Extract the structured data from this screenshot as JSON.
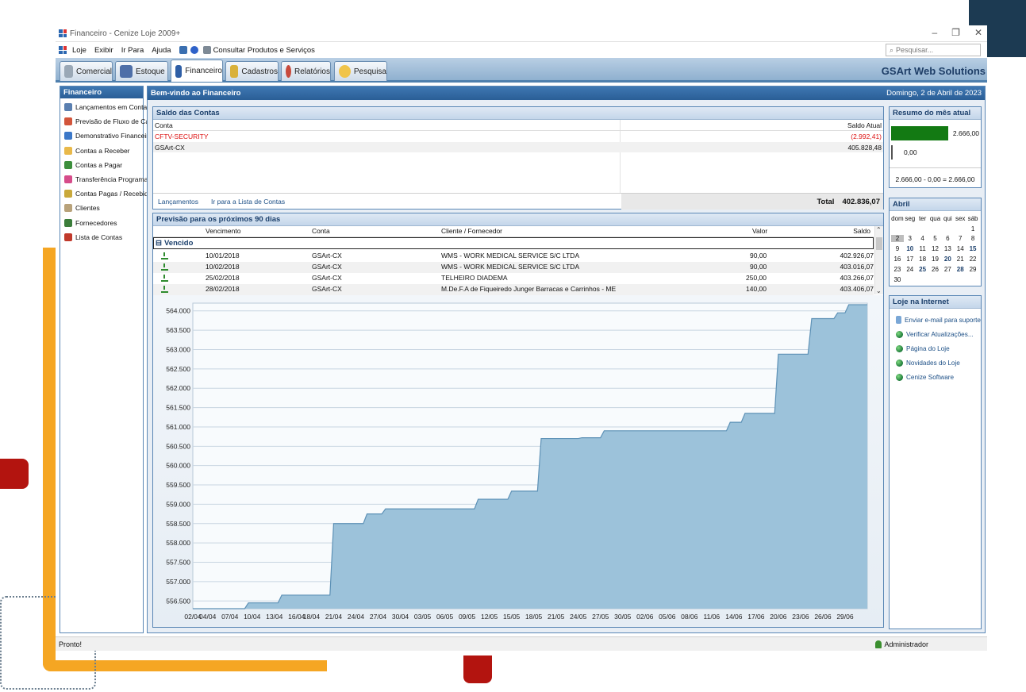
{
  "window": {
    "title": "Financeiro - Cenize Loje 2009+"
  },
  "menubar": {
    "items": [
      "Loje",
      "Exibir",
      "Ir Para",
      "Ajuda"
    ],
    "consultar": "Consultar Produtos e Serviços",
    "search_placeholder": "Pesquisar..."
  },
  "tabs": [
    "Comercial",
    "Estoque",
    "Financeiro",
    "Cadastros",
    "Relatórios",
    "Pesquisa"
  ],
  "brand": "GSArt Web Solutions",
  "sidebar": {
    "title": "Financeiro",
    "items": [
      "Lançamentos em Conta",
      "Previsão de Fluxo de Caixa",
      "Demonstrativo Financeiro",
      "Contas a Receber",
      "Contas a Pagar",
      "Transferência Programada",
      "Contas Pagas / Recebidas",
      "Clientes",
      "Fornecedores",
      "Lista de Contas"
    ]
  },
  "main": {
    "title": "Bem-vindo ao Financeiro",
    "date": "Domingo, 2 de Abril de 2023"
  },
  "saldo": {
    "title": "Saldo das Contas",
    "col_conta": "Conta",
    "col_saldo": "Saldo Atual",
    "rows": [
      {
        "conta": "CFTV-SECURITY",
        "saldo": "(2.992,41)"
      },
      {
        "conta": "GSArt-CX",
        "saldo": "405.828,48"
      }
    ],
    "link_lancamentos": "Lançamentos",
    "link_lista": "Ir para a Lista de Contas",
    "total_label": "Total",
    "total_value": "402.836,07"
  },
  "previsao": {
    "title": "Previsão para os próximos 90 dias",
    "cols": [
      "Vencimento",
      "Conta",
      "Cliente / Fornecedor",
      "Valor",
      "Saldo"
    ],
    "group": "Vencido",
    "rows": [
      {
        "venc": "10/01/2018",
        "conta": "GSArt-CX",
        "cliente": "WMS - WORK MEDICAL SERVICE S/C LTDA",
        "valor": "90,00",
        "saldo": "402.926,07"
      },
      {
        "venc": "10/02/2018",
        "conta": "GSArt-CX",
        "cliente": "WMS - WORK MEDICAL SERVICE S/C LTDA",
        "valor": "90,00",
        "saldo": "403.016,07"
      },
      {
        "venc": "25/02/2018",
        "conta": "GSArt-CX",
        "cliente": "TELHEIRO DIADEMA",
        "valor": "250,00",
        "saldo": "403.266,07"
      },
      {
        "venc": "28/02/2018",
        "conta": "GSArt-CX",
        "cliente": "M.De.F.A de Fiqueiredo Junger Barracas e Carrinhos - ME",
        "valor": "140,00",
        "saldo": "403.406,07"
      }
    ]
  },
  "chart_data": {
    "type": "area",
    "ylim": [
      556300,
      564200
    ],
    "yticks": [
      556500,
      557000,
      557500,
      558000,
      558500,
      559000,
      559500,
      560000,
      560500,
      561000,
      561500,
      562000,
      562500,
      563000,
      563500,
      564000
    ],
    "ytick_labels": [
      "556.500",
      "557.000",
      "557.500",
      "558.000",
      "558.500",
      "559.000",
      "559.500",
      "560.000",
      "560.500",
      "561.000",
      "561.500",
      "562.000",
      "562.500",
      "563.000",
      "563.500",
      "564.000"
    ],
    "xtick_labels": [
      "02/04",
      "04/04",
      "07/04",
      "10/04",
      "13/04",
      "16/04",
      "18/04",
      "21/04",
      "24/04",
      "27/04",
      "30/04",
      "03/05",
      "06/05",
      "09/05",
      "12/05",
      "15/05",
      "18/05",
      "21/05",
      "24/05",
      "27/05",
      "30/05",
      "02/06",
      "05/06",
      "08/06",
      "11/06",
      "14/06",
      "17/06",
      "20/06",
      "23/06",
      "26/06",
      "29/06"
    ],
    "x_days": [
      0,
      2,
      5,
      8,
      11,
      14,
      16,
      19,
      22,
      25,
      28,
      31,
      34,
      37,
      40,
      43,
      46,
      49,
      52,
      55,
      58,
      61,
      64,
      67,
      70,
      73,
      76,
      79,
      82,
      85,
      88
    ],
    "points_day": [
      0,
      7,
      7.5,
      11.5,
      12,
      16,
      16.5,
      18.5,
      19,
      23,
      23.5,
      25.5,
      26,
      38,
      38.5,
      42.5,
      43,
      46.5,
      47,
      52,
      52.5,
      55,
      55.5,
      67,
      67.5,
      72,
      72.5,
      74,
      74.5,
      78.5,
      79,
      83,
      83.5,
      86.5,
      87,
      88,
      88.5,
      91
    ],
    "points_value": [
      556300,
      556300,
      556450,
      556450,
      556650,
      556650,
      556650,
      556650,
      558500,
      558500,
      558750,
      558750,
      558880,
      558880,
      559130,
      559130,
      559340,
      559340,
      560700,
      560700,
      560720,
      560720,
      560900,
      560900,
      560900,
      560900,
      561120,
      561120,
      561350,
      561350,
      562880,
      562880,
      563800,
      563800,
      563950,
      563950,
      564160,
      564160
    ],
    "fill": "#9cc2da",
    "stroke": "#5d91b6",
    "grid": true
  },
  "resumo": {
    "title": "Resumo do mês atual",
    "receitas": "2.666,00",
    "receitas_fraction": 1.0,
    "despesas": "0,00",
    "despesas_fraction": 0.0,
    "formula": "2.666,00 - 0,00 = 2.666,00"
  },
  "calendar": {
    "month": "Abril",
    "days_header": [
      "dom",
      "seg",
      "ter",
      "qua",
      "qui",
      "sex",
      "sáb"
    ],
    "weeks": [
      [
        "",
        "",
        "",
        "",
        "",
        "",
        "1"
      ],
      [
        "2",
        "3",
        "4",
        "5",
        "6",
        "7",
        "8"
      ],
      [
        "9",
        "10",
        "11",
        "12",
        "13",
        "14",
        "15"
      ],
      [
        "16",
        "17",
        "18",
        "19",
        "20",
        "21",
        "22"
      ],
      [
        "23",
        "24",
        "25",
        "26",
        "27",
        "28",
        "29"
      ],
      [
        "30",
        "",
        "",
        "",
        "",
        "",
        ""
      ]
    ],
    "selected": "2",
    "bold": [
      "10",
      "15",
      "20",
      "25",
      "28"
    ]
  },
  "loja_net": {
    "title": "Loje na Internet",
    "items": [
      "Enviar e-mail para suporte",
      "Verificar Atualizações...",
      "Página do Loje",
      "Novidades do Loje",
      "Cenize Software"
    ]
  },
  "status": {
    "left": "Pronto!",
    "user": "Administrador"
  }
}
